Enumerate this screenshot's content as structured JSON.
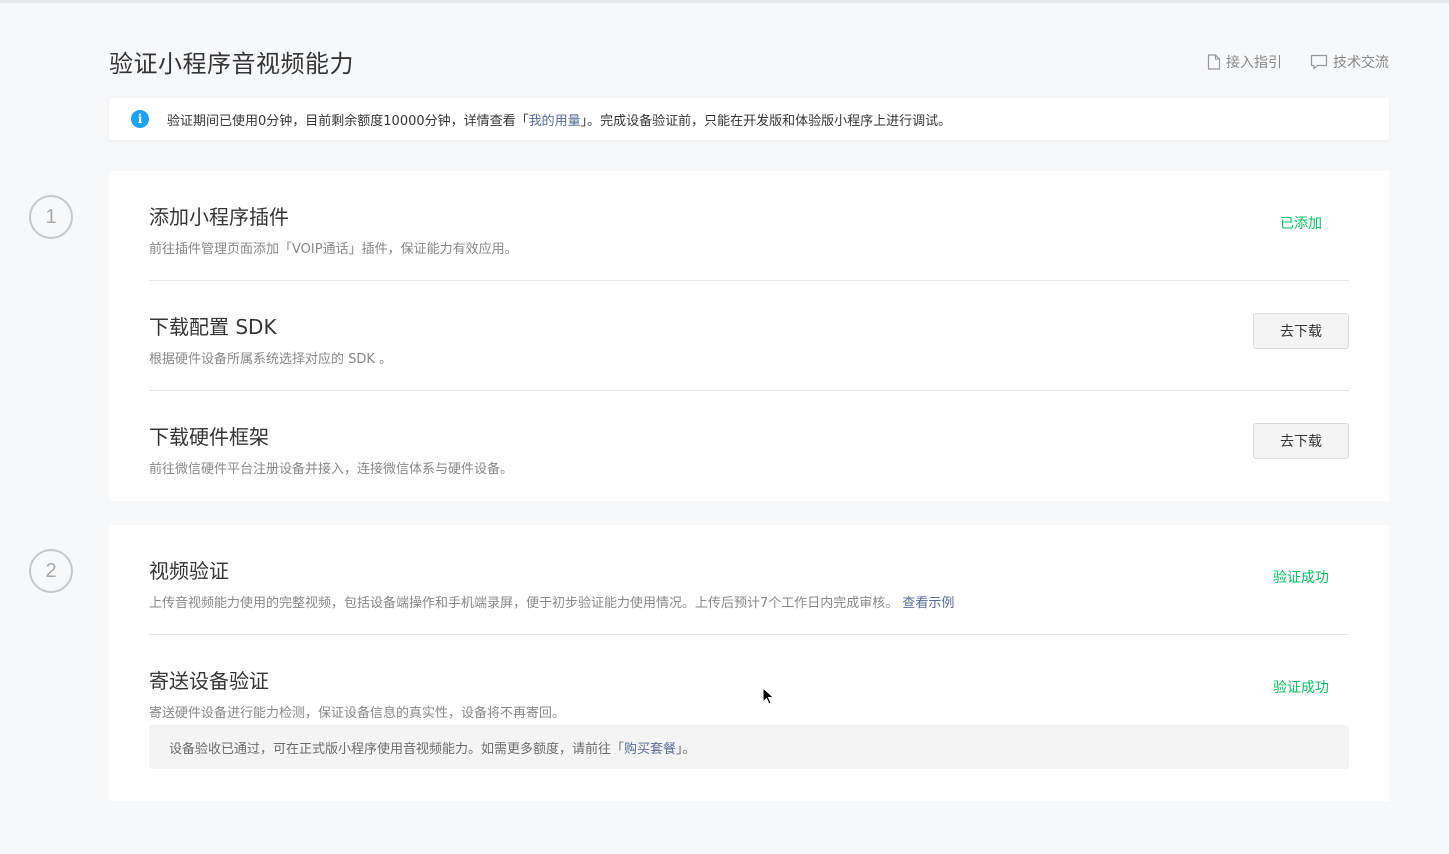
{
  "page": {
    "title": "验证小程序音视频能力",
    "links": [
      {
        "label": "接入指引",
        "icon": "document-icon"
      },
      {
        "label": "技术交流",
        "icon": "chat-icon"
      }
    ]
  },
  "notice": {
    "icon": "info-icon",
    "icon_glyph": "i",
    "text_before": "验证期间已使用0分钟，目前剩余额度10000分钟，详情查看「",
    "link": "我的用量",
    "text_after": "」。完成设备验证前，只能在开发版和体验版小程序上进行调试。"
  },
  "steps": [
    {
      "number": "1",
      "items": [
        {
          "title": "添加小程序插件",
          "desc": "前往插件管理页面添加「VOIP通话」插件，保证能力有效应用。",
          "status": "已添加"
        },
        {
          "title": "下载配置 SDK",
          "desc": "根据硬件设备所属系统选择对应的 SDK 。",
          "button": "去下载"
        },
        {
          "title": "下载硬件框架",
          "desc": "前往微信硬件平台注册设备并接入，连接微信体系与硬件设备。",
          "button": "去下载"
        }
      ]
    },
    {
      "number": "2",
      "items": [
        {
          "title": "视频验证",
          "desc": "上传音视频能力使用的完整视频，包括设备端操作和手机端录屏，便于初步验证能力使用情况。上传后预计7个工作日内完成审核。",
          "link": "查看示例",
          "status": "验证成功"
        },
        {
          "title": "寄送设备验证",
          "desc": "寄送硬件设备进行能力检测，保证设备信息的真实性，设备将不再寄回。",
          "status": "验证成功"
        }
      ],
      "tip": {
        "text_before": "设备验收已通过，可在正式版小程序使用音视频能力。如需更多额度，请前往「",
        "link": "购买套餐",
        "text_after": "」。"
      }
    }
  ],
  "colors": {
    "success": "#07c160",
    "link": "#576b95",
    "info": "#1aa3f3"
  }
}
